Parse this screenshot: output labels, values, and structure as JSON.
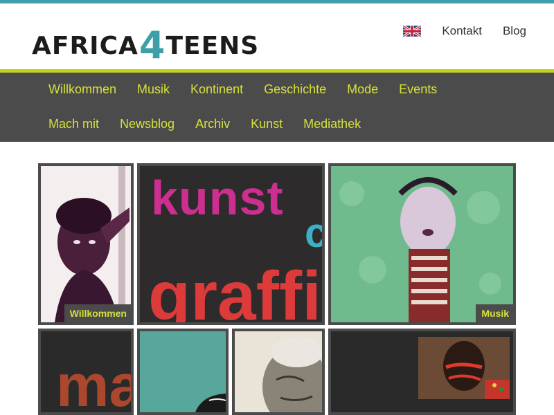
{
  "site": {
    "logo": {
      "part1": "AFRICA",
      "part2": "4",
      "part3": "TEENS"
    },
    "colors": {
      "accent": "#3f9fa8",
      "nav_bg": "#4b4b4b",
      "nav_text": "#d7e03a",
      "nav_border": "#c3d11c"
    }
  },
  "header": {
    "language_icon": "uk-flag-icon",
    "links": [
      {
        "label": "Kontakt"
      },
      {
        "label": "Blog"
      }
    ]
  },
  "nav": {
    "row1": [
      {
        "label": "Willkommen"
      },
      {
        "label": "Musik"
      },
      {
        "label": "Kontinent"
      },
      {
        "label": "Geschichte"
      },
      {
        "label": "Mode"
      },
      {
        "label": "Events"
      }
    ],
    "row2": [
      {
        "label": "Mach mit"
      },
      {
        "label": "Newsblog"
      },
      {
        "label": "Archiv"
      },
      {
        "label": "Kunst"
      },
      {
        "label": "Mediathek"
      }
    ]
  },
  "tiles": {
    "willkommen": {
      "label": "Willkommen"
    },
    "kunst": {
      "art_text_1": "kunst",
      "art_text_2": "graffi",
      "art_text_3": "c"
    },
    "musik": {
      "label": "Musik"
    },
    "mode": {
      "art_text": "ma"
    }
  }
}
